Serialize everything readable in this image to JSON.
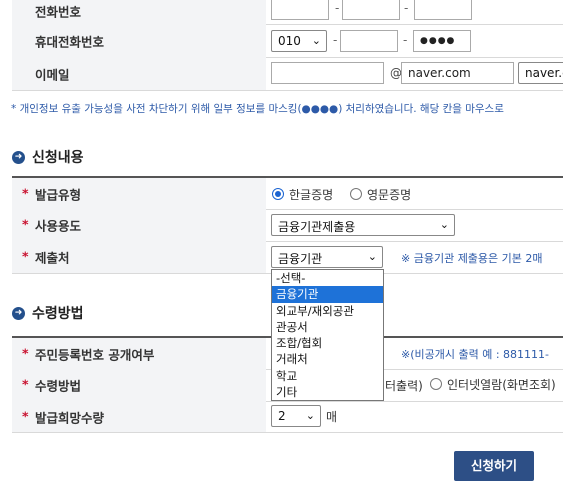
{
  "contact": {
    "phone_label": "전화번호",
    "mobile_label": "휴대전화번호",
    "mobile_prefix": "010",
    "mobile_last": "●●●●",
    "email_label": "이메일",
    "email_at": "@",
    "email_domain": "naver.com",
    "email_domain_select": "naver.com",
    "dash": "-"
  },
  "privacy_note": "* 개인정보 유출 가능성을 사전 차단하기 위해 일부 정보를 마스킹(●●●●) 처리하였습니다. 해당 칸을 마우스로",
  "application": {
    "section_title": "신청내용",
    "issue_type_label": "발급유형",
    "issue_type_options": [
      "한글증명",
      "영문증명"
    ],
    "issue_type_selected": "한글증명",
    "usage_label": "사용용도",
    "usage_value": "금융기관제출용",
    "submit_to_label": "제출처",
    "submit_to_value": "금융기관",
    "submit_note": "※ 금융기관 제출용은 기본 2매"
  },
  "dropdown": {
    "options": [
      "-선택-",
      "금융기관",
      "외교부/재외공관",
      "관공서",
      "조합/협회",
      "거래처",
      "학교",
      "기타"
    ],
    "highlighted_index": 1
  },
  "receipt": {
    "section_title": "수령방법",
    "rrn_label": "주민등록번호 공개여부",
    "rrn_note": "※(비공개시 출력 예 : 881111-",
    "method_label": "수령방법",
    "method_option_partial": "터출력)",
    "method_option_internet": "인터넷열람(화면조회)",
    "copies_label": "발급희망수량",
    "copies_value": "2",
    "copies_unit": "매"
  },
  "submit_button": "신청하기",
  "colors": {
    "accent": "#2d4f86",
    "star": "#c8102e",
    "note": "#2d5aa8",
    "highlight": "#1e72d8"
  },
  "icons": {
    "section": "arrow-right-circle-icon",
    "select": "chevron-down-icon"
  }
}
